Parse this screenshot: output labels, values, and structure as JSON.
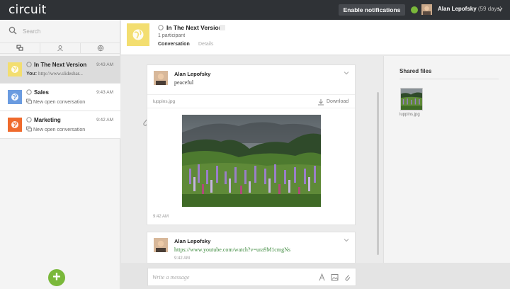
{
  "app": {
    "logo": "circuit",
    "notifications_button": "Enable notifications",
    "user_name": "Alan Lepofsky",
    "trial_text": "(59 days)",
    "status_color": "#7ab83a"
  },
  "sidebar": {
    "search_placeholder": "Search",
    "tabs": [
      "conversations-icon",
      "people-icon",
      "globe-icon"
    ],
    "conversations": [
      {
        "title": "In The Next Version",
        "time": "9:43 AM",
        "you_label": "You:",
        "preview": "http://www.slideshar...",
        "avatar_color": "#f3de70"
      },
      {
        "title": "Sales",
        "time": "9:43 AM",
        "preview": "New open conversation",
        "avatar_color": "#6a9be0"
      },
      {
        "title": "Marketing",
        "time": "9:42 AM",
        "preview": "New open conversation",
        "avatar_color": "#ef6a2c"
      }
    ],
    "add_label": "+"
  },
  "conversation": {
    "title": "In The Next Version",
    "participants": "1 participant",
    "tab_conversation": "Conversation",
    "tab_details": "Details"
  },
  "messages": [
    {
      "author": "Alan Lepofsky",
      "text": "peaceful",
      "file_name": "luppins.jpg",
      "download_label": "Download",
      "time": "9:42 AM"
    },
    {
      "author": "Alan Lepofsky",
      "text": "https://www.youtube.com/watch?v=ura9M1cmgNs",
      "time": "9:42 AM"
    }
  ],
  "composer": {
    "placeholder": "Write a message"
  },
  "shared_files": {
    "title": "Shared files",
    "files": [
      {
        "name": "luppins.jpg"
      }
    ]
  }
}
